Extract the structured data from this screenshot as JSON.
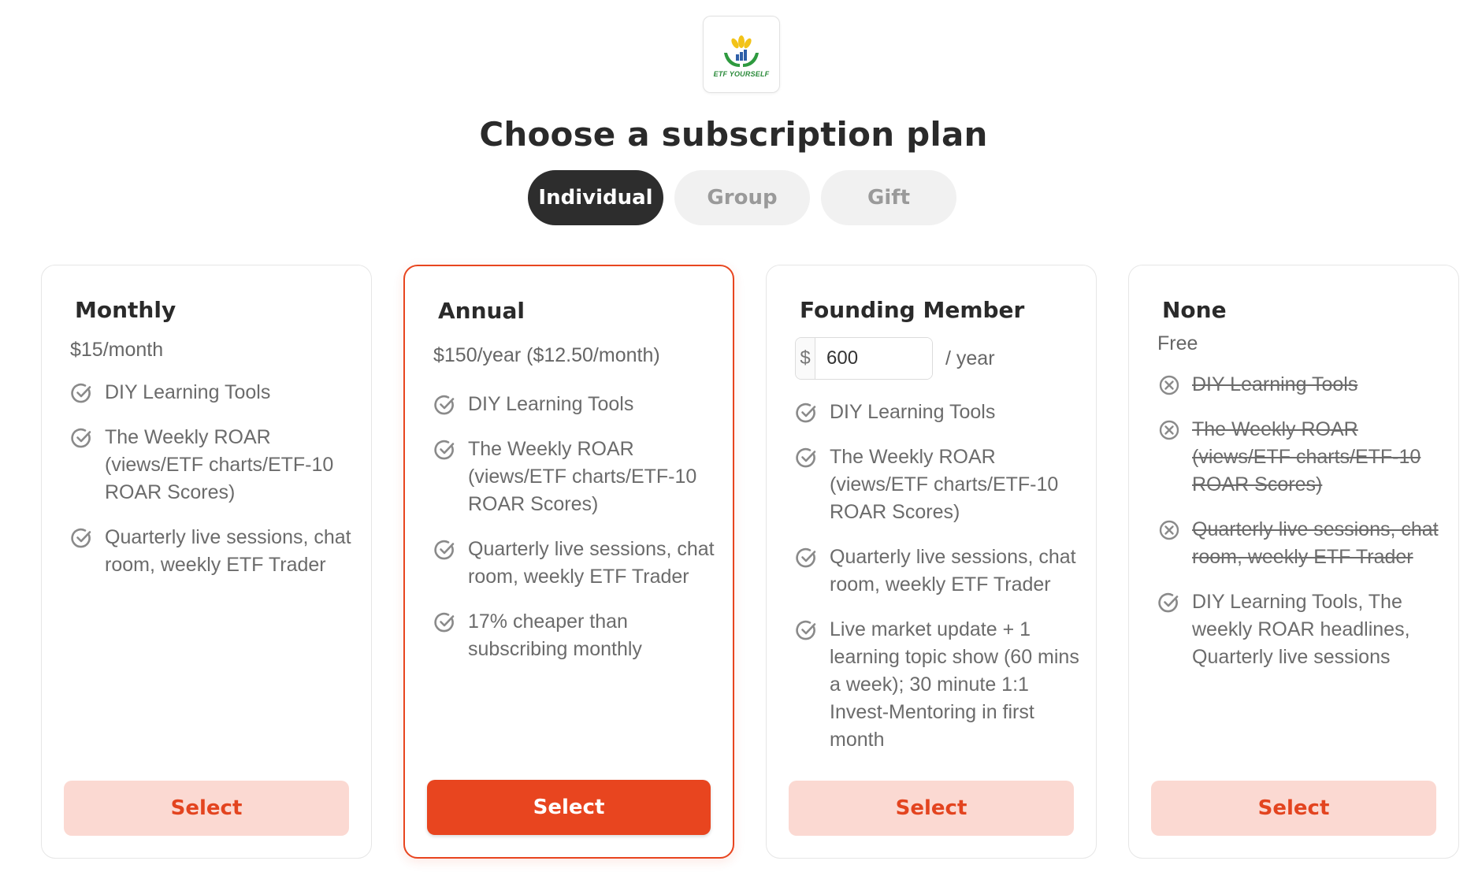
{
  "logo": {
    "text": "ETF YOURSELF",
    "icon": "hands-growth-logo"
  },
  "title": "Choose a subscription plan",
  "tabs": [
    {
      "label": "Individual",
      "active": true
    },
    {
      "label": "Group",
      "active": false
    },
    {
      "label": "Gift",
      "active": false
    }
  ],
  "colors": {
    "accent": "#e8451f",
    "accent_soft": "#fbd9d2",
    "dark": "#2d2d2d"
  },
  "plans": [
    {
      "name": "Monthly",
      "price": "$15/month",
      "features": [
        {
          "text": "DIY Learning Tools",
          "included": true
        },
        {
          "text": "The Weekly ROAR (views/ETF charts/ETF-10 ROAR Scores)",
          "included": true
        },
        {
          "text": "Quarterly live sessions, chat room, weekly ETF Trader",
          "included": true
        }
      ],
      "button": "Select",
      "selected": false
    },
    {
      "name": "Annual",
      "price": "$150/year ($12.50/month)",
      "features": [
        {
          "text": "DIY Learning Tools",
          "included": true
        },
        {
          "text": "The Weekly ROAR (views/ETF charts/ETF-10 ROAR Scores)",
          "included": true
        },
        {
          "text": "Quarterly live sessions, chat room, weekly ETF Trader",
          "included": true
        },
        {
          "text": "17% cheaper than subscribing monthly",
          "included": true
        }
      ],
      "button": "Select",
      "selected": true
    },
    {
      "name": "Founding Member",
      "amount": {
        "currency": "$",
        "value": "600",
        "suffix": "/ year"
      },
      "features": [
        {
          "text": "DIY Learning Tools",
          "included": true
        },
        {
          "text": "The Weekly ROAR (views/ETF charts/ETF-10 ROAR Scores)",
          "included": true
        },
        {
          "text": "Quarterly live sessions, chat room, weekly ETF Trader",
          "included": true
        },
        {
          "text": "Live market update + 1 learning topic show (60 mins a week); 30 minute 1:1 Invest-Mentoring in first month",
          "included": true
        }
      ],
      "button": "Select",
      "selected": false
    },
    {
      "name": "None",
      "price": "Free",
      "features": [
        {
          "text": "DIY Learning Tools",
          "included": false
        },
        {
          "text": "The Weekly ROAR (views/ETF charts/ETF-10 ROAR Scores)",
          "included": false
        },
        {
          "text": "Quarterly live sessions, chat room, weekly ETF Trader",
          "included": false
        },
        {
          "text": "DIY Learning Tools, The weekly ROAR headlines, Quarterly live sessions",
          "included": true
        }
      ],
      "button": "Select",
      "selected": false
    }
  ]
}
